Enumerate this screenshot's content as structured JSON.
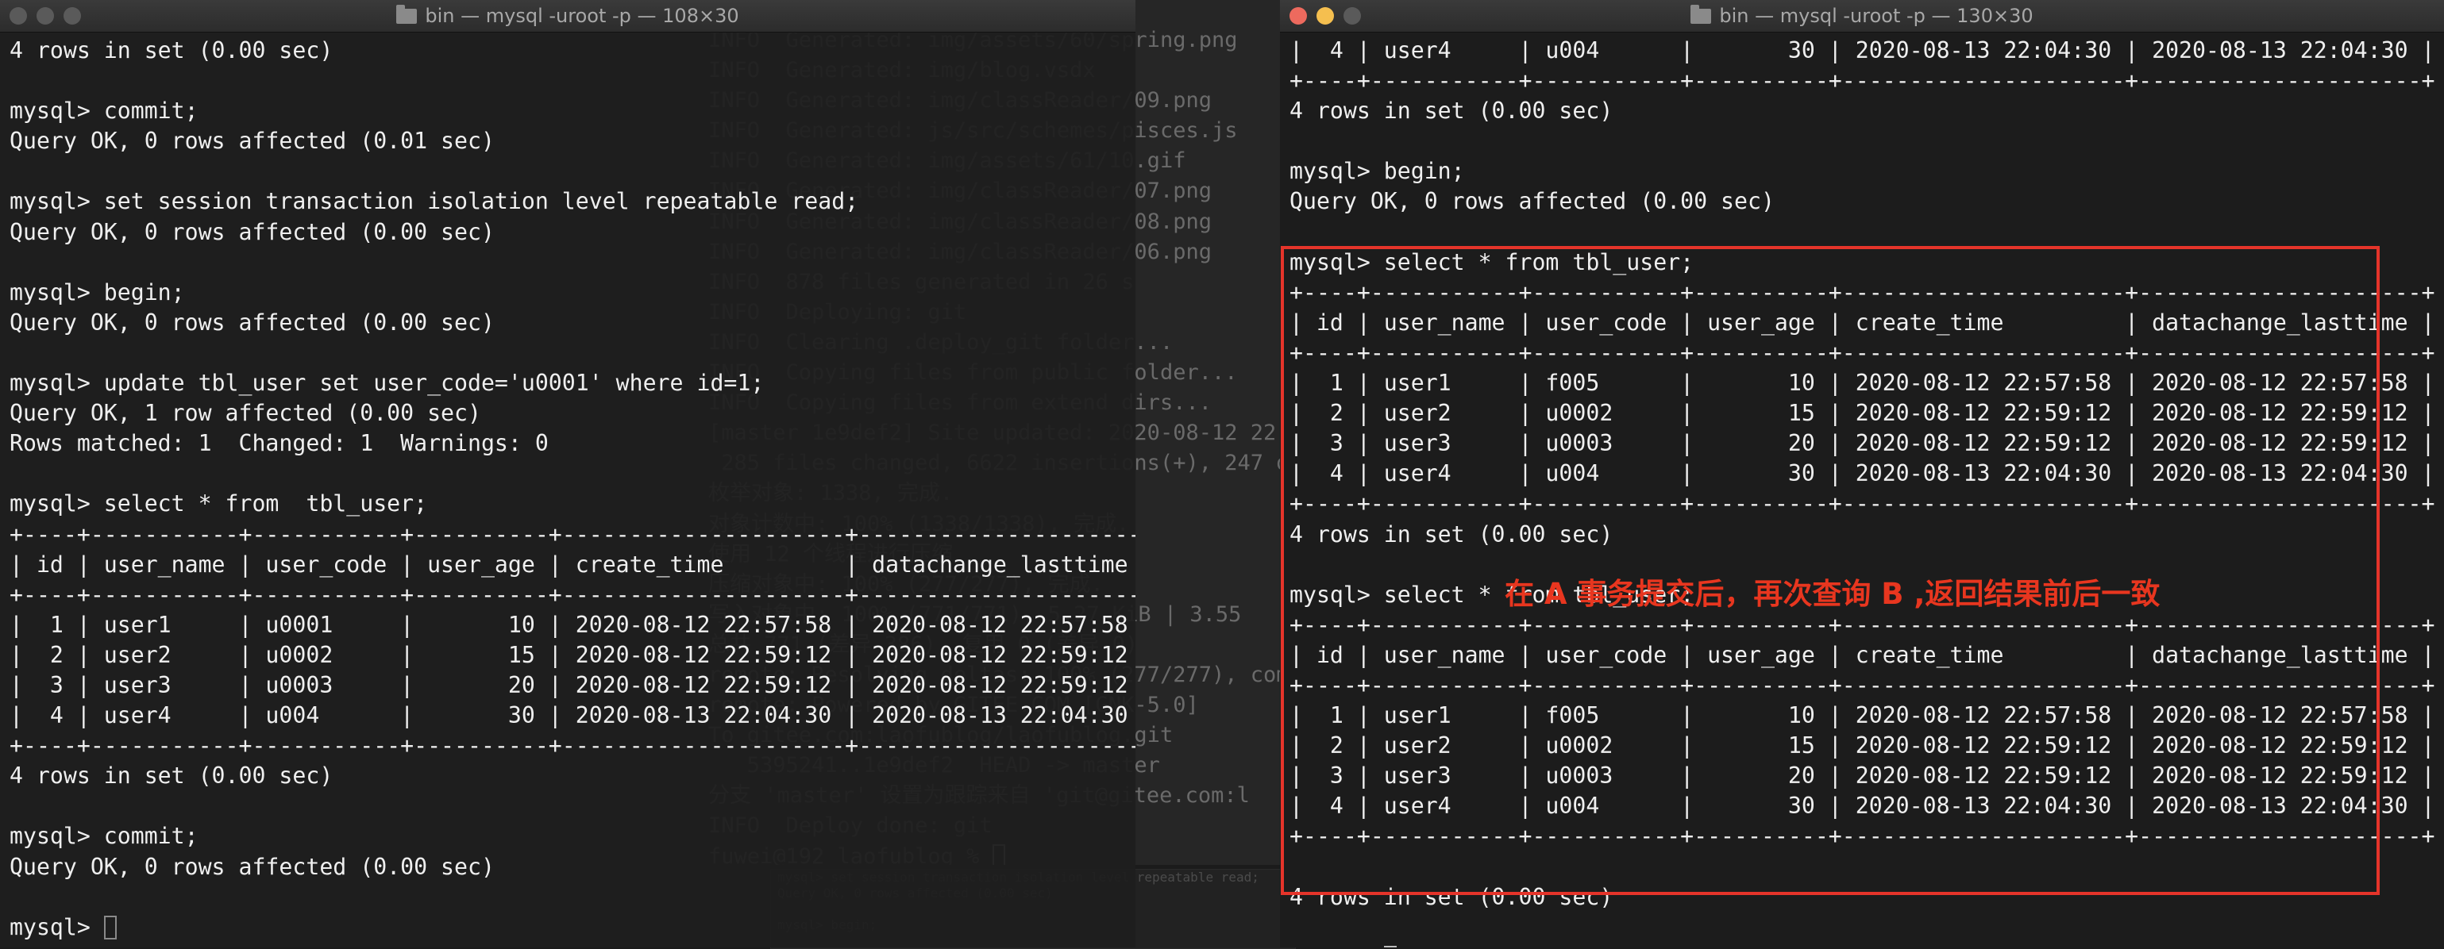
{
  "background_window": {
    "lines": [
      {
        "text": "INFO  Generated: img/assets/60/spring.png",
        "pink": false
      },
      {
        "text": "INFO  Generated: img/blog.vsdx",
        "pink": false
      },
      {
        "text": "INFO  Generated: img/classReader/09.png",
        "pink": false
      },
      {
        "text": "INFO  Generated: js/src/schemes/pisces.js",
        "pink": false
      },
      {
        "text": "INFO  Generated: img/assets/61/10.gif",
        "pink": false
      },
      {
        "text": "INFO  Generated: img/classReader/07.png",
        "pink": false
      },
      {
        "text": "INFO  Generated: img/classReader/08.png",
        "pink": false
      },
      {
        "text": "INFO  Generated: img/classReader/06.png",
        "pink": false
      },
      {
        "text": "INFO  878 files generated in 26 s",
        "pink": false
      },
      {
        "text": "INFO  Deploying: git",
        "pink": false
      },
      {
        "text": "INFO  Clearing .deploy_git folder...",
        "pink": false
      },
      {
        "text": "INFO  Copying files from public folder...",
        "pink": false
      },
      {
        "text": "INFO  Copying files from extend dirs...",
        "pink": false
      },
      {
        "text": "[master 1e9def2] Site updated: 2020-08-12 22:",
        "pink": false
      },
      {
        "text": " 285 files changed, 6622 insertions(+), 247 d",
        "pink": false
      },
      {
        "text": "枚举对象: 1338, 完成.",
        "pink": false
      },
      {
        "text": "对象计数中: 100% (1338/1338), 完成.",
        "pink": false
      },
      {
        "text": "使用 12 个线程进行压缩",
        "pink": false
      },
      {
        "text": "压缩对象中: 100% (277/277), 完成.",
        "pink": false
      },
      {
        "text": "写入对象中: 100% (771/771), 5.27 KiB | 3.55",
        "pink": false
      },
      {
        "text": "总共 771 (差异 386), 复用 0 (差异 0)",
        "pink": false
      },
      {
        "text": "remote: Resolving deltas: 100% (277/277), com",
        "pink": false
      },
      {
        "text": "remote: Powered by GITEE.COM [GNK-5.0]",
        "pink": false
      },
      {
        "text": "To gitee.com:laofublog/laofublog.git",
        "pink": false
      },
      {
        "text": "   5395241..1e9def2  HEAD -> master",
        "pink": false
      },
      {
        "text": "分支 'master' 设置为跟踪来自 'git@gitee.com:l",
        "pink": false
      },
      {
        "text": "INFO  Deploy done: git",
        "pink": false
      },
      {
        "text": "fuwei@192 laofublog % ",
        "pink": false
      }
    ]
  },
  "left_window": {
    "title": "bin — mysql -uroot -p — 108×30",
    "lines": [
      "4 rows in set (0.00 sec)",
      "",
      "mysql> commit;",
      "Query OK, 0 rows affected (0.01 sec)",
      "",
      "mysql> set session transaction isolation level repeatable read;",
      "Query OK, 0 rows affected (0.00 sec)",
      "",
      "mysql> begin;",
      "Query OK, 0 rows affected (0.00 sec)",
      "",
      "mysql> update tbl_user set user_code='u0001' where id=1;",
      "Query OK, 1 row affected (0.00 sec)",
      "Rows matched: 1  Changed: 1  Warnings: 0",
      "",
      "mysql> select * from  tbl_user;",
      "+----+-----------+-----------+----------+---------------------+---------------------+",
      "| id | user_name | user_code | user_age | create_time         | datachange_lasttime |",
      "+----+-----------+-----------+----------+---------------------+---------------------+",
      "|  1 | user1     | u0001     |       10 | 2020-08-12 22:57:58 | 2020-08-12 22:57:58 |",
      "|  2 | user2     | u0002     |       15 | 2020-08-12 22:59:12 | 2020-08-12 22:59:12 |",
      "|  3 | user3     | u0003     |       20 | 2020-08-12 22:59:12 | 2020-08-12 22:59:12 |",
      "|  4 | user4     | u004      |       30 | 2020-08-13 22:04:30 | 2020-08-13 22:04:30 |",
      "+----+-----------+-----------+----------+---------------------+---------------------+",
      "4 rows in set (0.00 sec)",
      "",
      "mysql> commit;",
      "Query OK, 0 rows affected (0.00 sec)",
      "",
      "mysql> "
    ]
  },
  "right_window": {
    "title": "bin — mysql -uroot -p — 130×30",
    "lines": [
      "|  4 | user4     | u004      |       30 | 2020-08-13 22:04:30 | 2020-08-13 22:04:30 |",
      "+----+-----------+-----------+----------+---------------------+---------------------+",
      "4 rows in set (0.00 sec)",
      "",
      "mysql> begin;",
      "Query OK, 0 rows affected (0.00 sec)",
      "",
      "mysql> select * from tbl_user;",
      "+----+-----------+-----------+----------+---------------------+---------------------+",
      "| id | user_name | user_code | user_age | create_time         | datachange_lasttime |",
      "+----+-----------+-----------+----------+---------------------+---------------------+",
      "|  1 | user1     | f005      |       10 | 2020-08-12 22:57:58 | 2020-08-12 22:57:58 |",
      "|  2 | user2     | u0002     |       15 | 2020-08-12 22:59:12 | 2020-08-12 22:59:12 |",
      "|  3 | user3     | u0003     |       20 | 2020-08-12 22:59:12 | 2020-08-12 22:59:12 |",
      "|  4 | user4     | u004      |       30 | 2020-08-13 22:04:30 | 2020-08-13 22:04:30 |",
      "+----+-----------+-----------+----------+---------------------+---------------------+",
      "4 rows in set (0.00 sec)",
      "",
      "mysql> select * from tbl_user;",
      "+----+-----------+-----------+----------+---------------------+---------------------+",
      "| id | user_name | user_code | user_age | create_time         | datachange_lasttime |",
      "+----+-----------+-----------+----------+---------------------+---------------------+",
      "|  1 | user1     | f005      |       10 | 2020-08-12 22:57:58 | 2020-08-12 22:57:58 |",
      "|  2 | user2     | u0002     |       15 | 2020-08-12 22:59:12 | 2020-08-12 22:59:12 |",
      "|  3 | user3     | u0003     |       20 | 2020-08-12 22:59:12 | 2020-08-12 22:59:12 |",
      "|  4 | user4     | u004      |       30 | 2020-08-13 22:04:30 | 2020-08-13 22:04:30 |",
      "+----+-----------+-----------+----------+---------------------+---------------------+",
      "",
      "4 rows in set (0.00 sec)",
      "",
      "mysql> "
    ]
  },
  "annotation": "在 A 事务提交后，再次查询 B ,返回结果前后一致",
  "ghost_window": {
    "lines": [
      "mysql> set session transaction isolation level repeatable read;",
      "Query OK, 0 rows affected (0.00 sec)",
      "",
      "mysql> begin;"
    ]
  },
  "ghost_window_right": {
    "lines": [
      "| id | user_name | user_code | user_age | create_time         | datachange_lasttime |",
      "+----+-----------+-----------+----------+---------------------+---------------------+",
      "|  1 | user1     | f005      |       10 | 2020-08-12 22:57:58 | 2020-08-12 22:57:58 |"
    ]
  },
  "colors": {
    "close": "#ed6a5e",
    "minimize": "#f5bf4f",
    "zoom": "#61c554",
    "inactive_dot": "#5a5a5a",
    "terminal_bg": "#1e1e1e",
    "background_terminal_bg": "#262626",
    "highlight": "#e5342a"
  }
}
